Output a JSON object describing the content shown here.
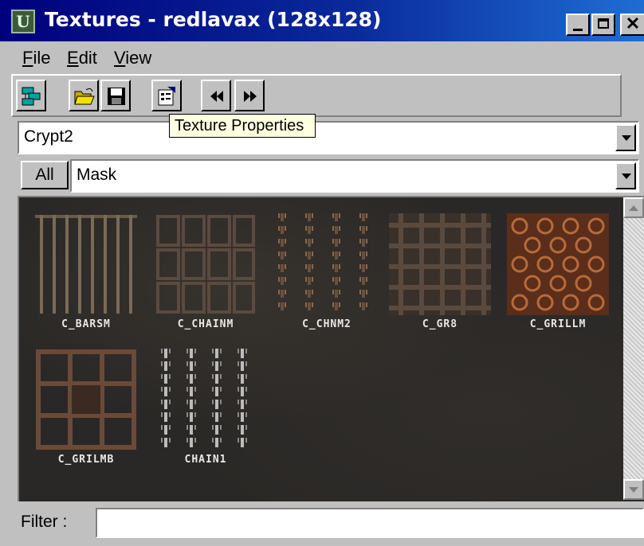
{
  "window": {
    "title": "Textures - redlavax (128x128)",
    "icon": "unreal-editor-icon",
    "controls": [
      "minimize",
      "maximize",
      "close"
    ]
  },
  "menu": [
    {
      "accel": "F",
      "rest": "ile"
    },
    {
      "accel": "E",
      "rest": "dit"
    },
    {
      "accel": "V",
      "rest": "iew"
    }
  ],
  "toolbar": {
    "buttons": [
      "browse-icon",
      "open-folder-icon",
      "save-disk-icon",
      "texture-properties-icon",
      "previous-icon",
      "next-icon"
    ]
  },
  "tooltip": "Texture Properties",
  "package_combo": {
    "value": "Crypt2"
  },
  "group_bar": {
    "all_label": "All",
    "value": "Mask"
  },
  "textures": [
    {
      "name": "C_BARSM",
      "kind": "bars"
    },
    {
      "name": "C_CHAINM",
      "kind": "chain-grid"
    },
    {
      "name": "C_CHNM2",
      "kind": "chains"
    },
    {
      "name": "C_GR8",
      "kind": "grate"
    },
    {
      "name": "C_GRILLM",
      "kind": "grill"
    },
    {
      "name": "C_GRILMB",
      "kind": "grill-big"
    },
    {
      "name": "CHAIN1",
      "kind": "chains-silver"
    }
  ],
  "filter": {
    "label": "Filter :",
    "value": ""
  },
  "colors": {
    "titlebar_start": "#00007c",
    "titlebar_end": "#1f6ed4",
    "face": "#c0c0c0",
    "tooltip": "#ffffe1",
    "viewer_bg": "#2a2826"
  }
}
